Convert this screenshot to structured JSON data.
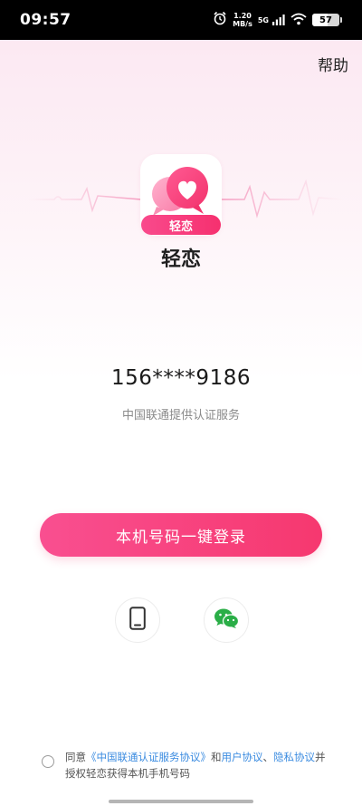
{
  "status_bar": {
    "time": "09:57",
    "speed_value": "1.20",
    "speed_unit": "MB/s",
    "network": "5G",
    "battery": "57",
    "battery_level": 0.57
  },
  "header": {
    "help_label": "帮助"
  },
  "app": {
    "logo_badge": "轻恋",
    "name": "轻恋"
  },
  "login": {
    "phone_number": "156****9186",
    "carrier_note": "中国联通提供认证服务",
    "button_label": "本机号码一键登录"
  },
  "alt_login": {
    "phone_icon": "phone-icon",
    "wechat_icon": "wechat-icon"
  },
  "agreement": {
    "prefix": "同意",
    "carrier_terms": "《中国联通认证服务协议》",
    "and": "和",
    "user_agreement": "用户协议",
    "separator": "、",
    "privacy_policy": "隐私协议",
    "suffix": "并授权轻恋获得本机手机号码"
  },
  "colors": {
    "accent": "#f6386f",
    "accent_start": "#f94f90",
    "link": "#3a8be0",
    "wechat_green": "#2aae47"
  }
}
